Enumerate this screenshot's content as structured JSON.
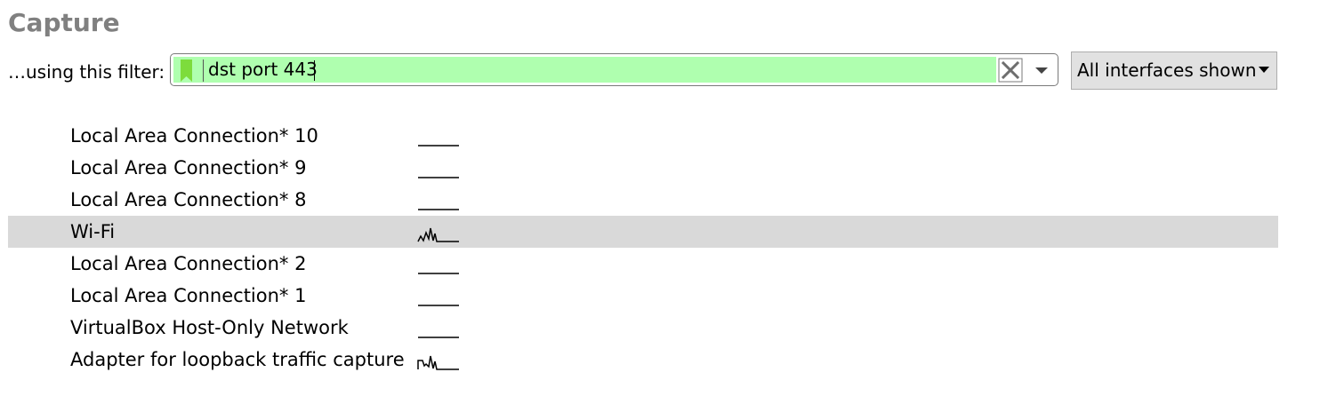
{
  "section": {
    "title": "Capture"
  },
  "filter": {
    "label": "…using this filter:",
    "value": "dst port 443",
    "background_color": "#afffaf",
    "bookmark_icon": "bookmark-icon",
    "clear_icon": "clear-x-icon",
    "dropdown_icon": "chevron-down-icon"
  },
  "interfaces_button": {
    "label": "All interfaces shown"
  },
  "interfaces": [
    {
      "name": "Local Area Connection* 10",
      "activity": "flat"
    },
    {
      "name": "Local Area Connection* 9",
      "activity": "flat"
    },
    {
      "name": "Local Area Connection* 8",
      "activity": "flat"
    },
    {
      "name": "Wi-Fi",
      "activity": "spiky",
      "selected": true
    },
    {
      "name": "Local Area Connection* 2",
      "activity": "flat"
    },
    {
      "name": "Local Area Connection* 1",
      "activity": "flat"
    },
    {
      "name": "VirtualBox Host-Only Network",
      "activity": "flat"
    },
    {
      "name": "Adapter for loopback traffic capture",
      "activity": "spiky"
    }
  ],
  "colors": {
    "title": "#808080",
    "selected_row": "#d9d9d9",
    "button_bg": "#e1e1e1",
    "bookmark": "#7ddc3c"
  }
}
